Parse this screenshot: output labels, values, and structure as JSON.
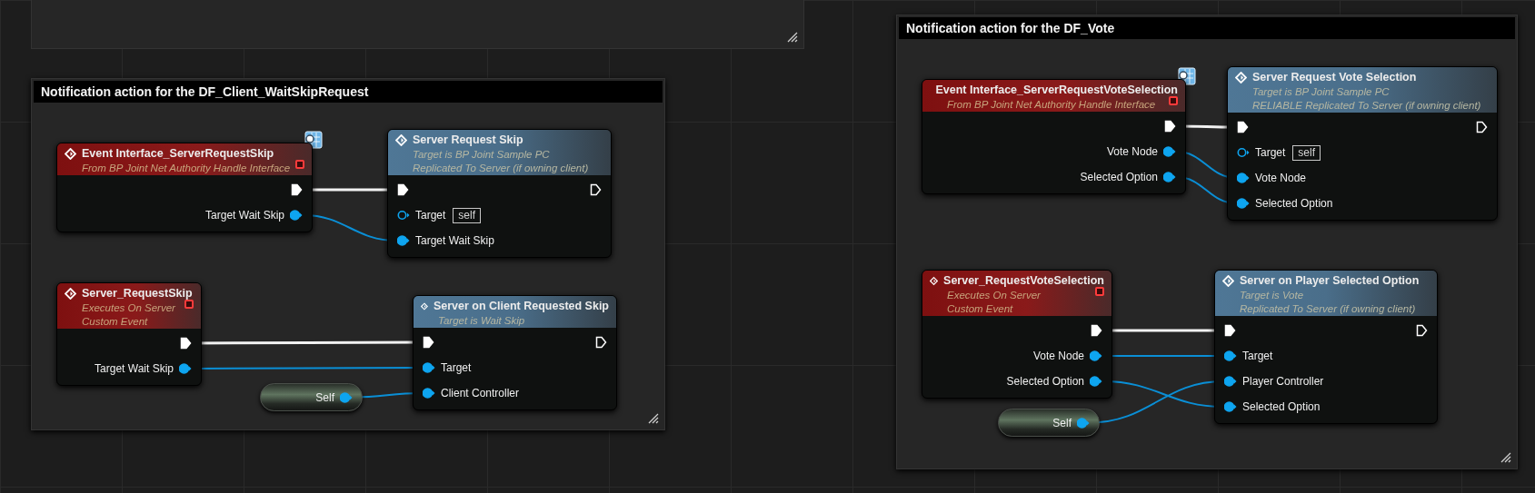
{
  "comments": [
    {
      "title": "Notification action for the DF_Client_WaitSkipRequest",
      "nodes": [
        {
          "kind": "event",
          "title": "Event Interface_ServerRequestSkip",
          "subtitle": [
            "From BP Joint Net Authority Handle Interface"
          ],
          "badge": true,
          "outputs": [
            {
              "kind": "exec",
              "connected": true
            },
            {
              "kind": "data",
              "label": "Target Wait Skip",
              "connected": true
            }
          ]
        },
        {
          "kind": "function",
          "title": "Server Request Skip",
          "subtitle": [
            "Target is BP Joint Sample PC",
            "Replicated To Server (if owning client)"
          ],
          "inputs": [
            {
              "kind": "exec",
              "connected": true
            },
            {
              "kind": "data",
              "label": "Target",
              "connected": false,
              "default": "self"
            },
            {
              "kind": "data",
              "label": "Target Wait Skip",
              "connected": true
            }
          ],
          "outputs": [
            {
              "kind": "exec",
              "connected": false
            }
          ]
        },
        {
          "kind": "event",
          "title": "Server_RequestSkip",
          "subtitle": [
            "Executes On Server",
            "Custom Event"
          ],
          "badge": false,
          "outputs": [
            {
              "kind": "exec",
              "connected": true
            },
            {
              "kind": "data",
              "label": "Target Wait Skip",
              "connected": true
            }
          ]
        },
        {
          "kind": "function",
          "title": "Server on Client Requested Skip",
          "subtitle": [
            "Target is Wait Skip"
          ],
          "inputs": [
            {
              "kind": "exec",
              "connected": true
            },
            {
              "kind": "data",
              "label": "Target",
              "connected": true
            },
            {
              "kind": "data",
              "label": "Client Controller",
              "connected": true
            }
          ],
          "outputs": [
            {
              "kind": "exec",
              "connected": false
            }
          ]
        },
        {
          "kind": "self",
          "outputs": [
            {
              "kind": "data",
              "label": "Self",
              "connected": true
            }
          ]
        }
      ]
    },
    {
      "title": "Notification action for the DF_Vote",
      "nodes": [
        {
          "kind": "event",
          "title": "Event Interface_ServerRequestVoteSelection",
          "subtitle": [
            "From BP Joint Net Authority Handle Interface"
          ],
          "badge": true,
          "outputs": [
            {
              "kind": "exec",
              "connected": true
            },
            {
              "kind": "data",
              "label": "Vote Node",
              "connected": true
            },
            {
              "kind": "data",
              "label": "Selected Option",
              "connected": true
            }
          ]
        },
        {
          "kind": "function",
          "title": "Server Request Vote Selection",
          "subtitle": [
            "Target is BP Joint Sample PC",
            "RELIABLE Replicated To Server (if owning client)"
          ],
          "inputs": [
            {
              "kind": "exec",
              "connected": true
            },
            {
              "kind": "data",
              "label": "Target",
              "connected": false,
              "default": "self"
            },
            {
              "kind": "data",
              "label": "Vote Node",
              "connected": true
            },
            {
              "kind": "data",
              "label": "Selected Option",
              "connected": true
            }
          ],
          "outputs": [
            {
              "kind": "exec",
              "connected": false
            }
          ]
        },
        {
          "kind": "event",
          "title": "Server_RequestVoteSelection",
          "subtitle": [
            "Executes On Server",
            "Custom Event"
          ],
          "badge": false,
          "outputs": [
            {
              "kind": "exec",
              "connected": true
            },
            {
              "kind": "data",
              "label": "Vote Node",
              "connected": true
            },
            {
              "kind": "data",
              "label": "Selected Option",
              "connected": true
            }
          ]
        },
        {
          "kind": "function",
          "title": "Server on Player Selected Option",
          "subtitle": [
            "Target is Vote",
            "Replicated To Server (if owning client)"
          ],
          "inputs": [
            {
              "kind": "exec",
              "connected": true
            },
            {
              "kind": "data",
              "label": "Target",
              "connected": true
            },
            {
              "kind": "data",
              "label": "Player Controller",
              "connected": true
            },
            {
              "kind": "data",
              "label": "Selected Option",
              "connected": true
            }
          ],
          "outputs": [
            {
              "kind": "exec",
              "connected": false
            }
          ]
        },
        {
          "kind": "self",
          "outputs": [
            {
              "kind": "data",
              "label": "Self",
              "connected": true
            }
          ]
        }
      ]
    }
  ]
}
